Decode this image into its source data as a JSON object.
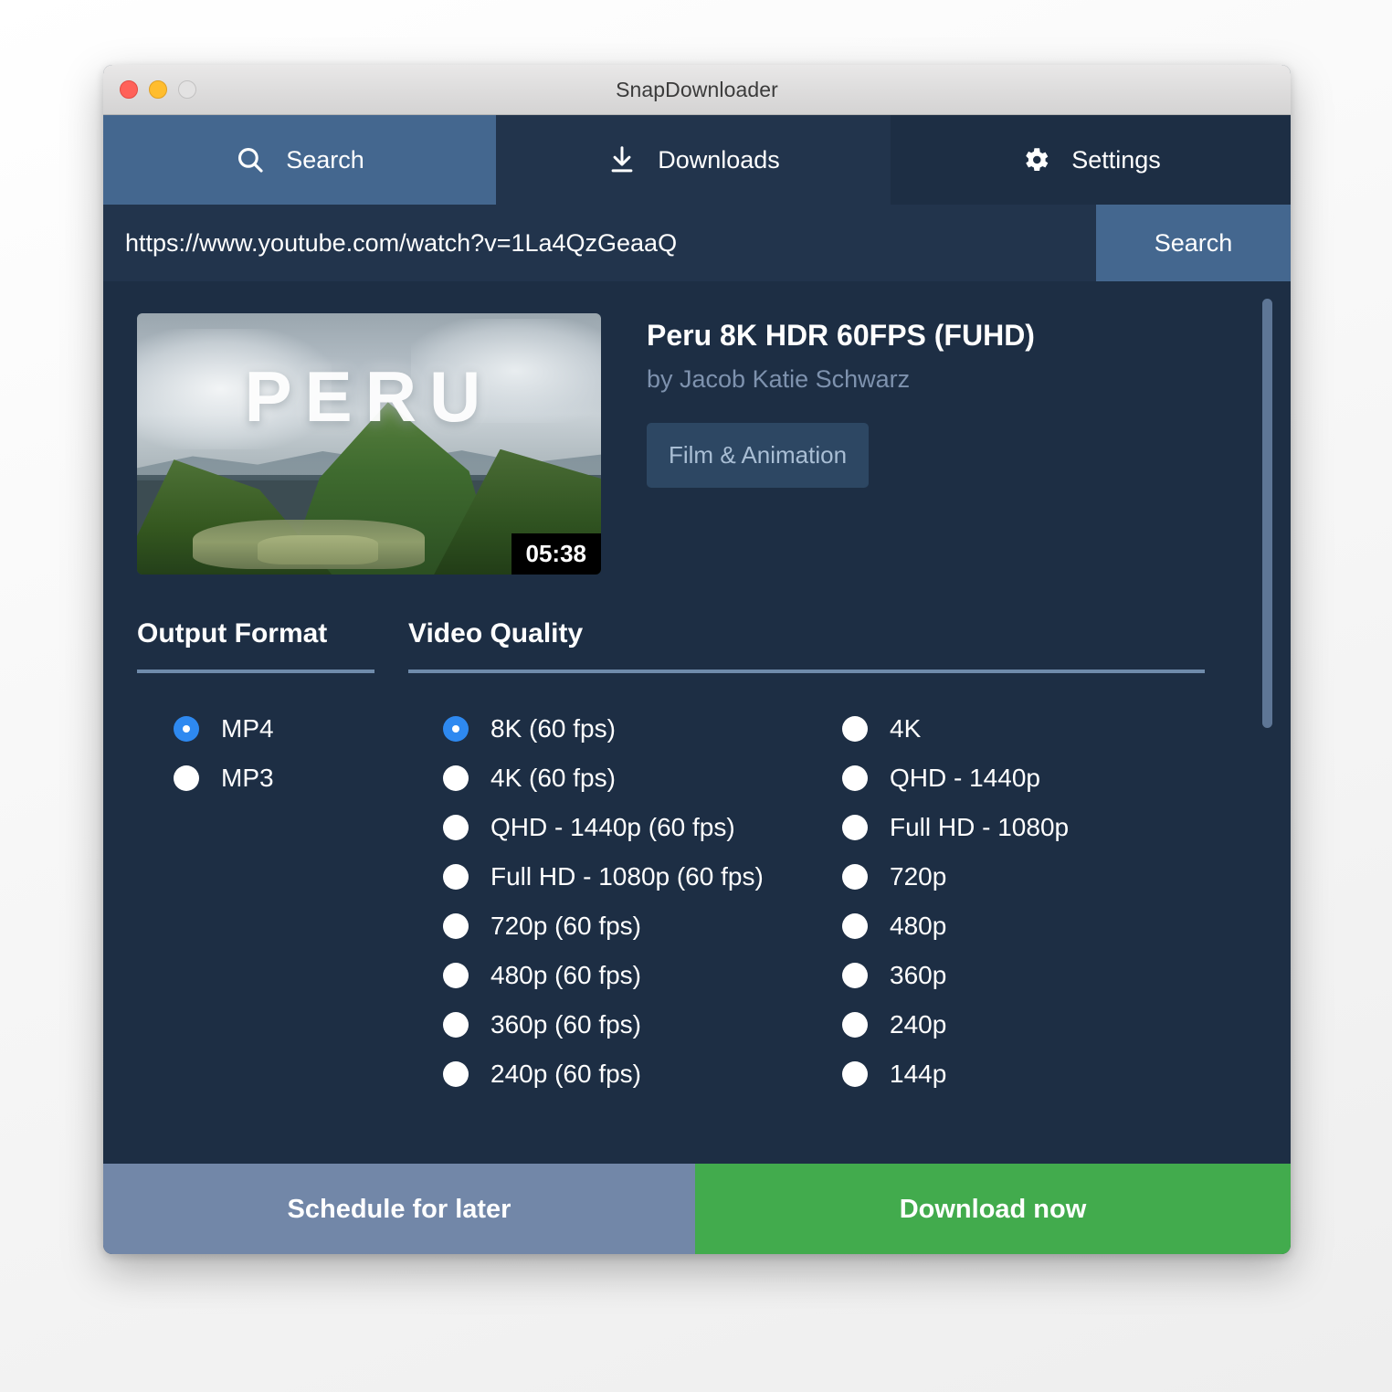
{
  "window": {
    "title": "SnapDownloader",
    "traffic_lights": [
      "close",
      "minimize",
      "zoom"
    ]
  },
  "tabs": [
    {
      "id": "search",
      "label": "Search",
      "icon": "search-icon",
      "active": true
    },
    {
      "id": "downloads",
      "label": "Downloads",
      "icon": "download-icon",
      "active": false
    },
    {
      "id": "settings",
      "label": "Settings",
      "icon": "gear-icon",
      "active": false
    }
  ],
  "urlbar": {
    "value": "https://www.youtube.com/watch?v=1La4QzGeaaQ",
    "placeholder": "Paste a video link here",
    "search_label": "Search"
  },
  "video": {
    "title": "Peru 8K HDR 60FPS (FUHD)",
    "author": "by Jacob Katie Schwarz",
    "category": "Film & Animation",
    "duration": "05:38",
    "thumbnail_text": "PERU"
  },
  "output_format": {
    "heading": "Output Format",
    "options": [
      {
        "label": "MP4",
        "checked": true
      },
      {
        "label": "MP3",
        "checked": false
      }
    ]
  },
  "video_quality": {
    "heading": "Video Quality",
    "column_a": [
      {
        "label": "8K (60 fps)",
        "checked": true
      },
      {
        "label": "4K (60 fps)",
        "checked": false
      },
      {
        "label": "QHD - 1440p (60 fps)",
        "checked": false
      },
      {
        "label": "Full HD - 1080p (60 fps)",
        "checked": false
      },
      {
        "label": "720p (60 fps)",
        "checked": false
      },
      {
        "label": "480p (60 fps)",
        "checked": false
      },
      {
        "label": "360p (60 fps)",
        "checked": false
      },
      {
        "label": "240p (60 fps)",
        "checked": false
      }
    ],
    "column_b": [
      {
        "label": "4K",
        "checked": false
      },
      {
        "label": "QHD - 1440p",
        "checked": false
      },
      {
        "label": "Full HD - 1080p",
        "checked": false
      },
      {
        "label": "720p",
        "checked": false
      },
      {
        "label": "480p",
        "checked": false
      },
      {
        "label": "360p",
        "checked": false
      },
      {
        "label": "240p",
        "checked": false
      },
      {
        "label": "144p",
        "checked": false
      }
    ]
  },
  "footer": {
    "schedule_label": "Schedule for later",
    "download_label": "Download now"
  },
  "colors": {
    "app_bg": "#1d2e44",
    "tab_active": "#44678f",
    "tab_inactive": "#22344c",
    "input_bg": "#22344c",
    "accent_radio": "#2e89f0",
    "rule": "#6f8bab",
    "schedule_btn": "#7287a8",
    "download_btn": "#42ab4d",
    "muted_text": "#7e92ae"
  }
}
